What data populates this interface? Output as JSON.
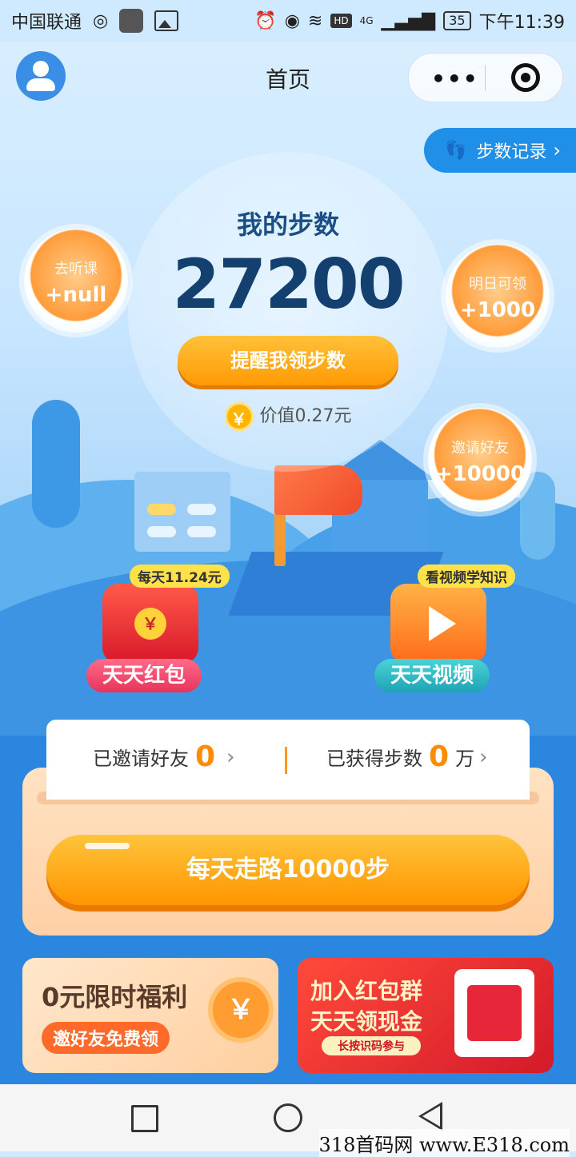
{
  "status_bar": {
    "carrier": "中国联通",
    "network": "4G",
    "battery": "35",
    "time": "下午11:39"
  },
  "header": {
    "title": "首页",
    "step_record_label": "步数记录"
  },
  "steps": {
    "label": "我的步数",
    "count": "27200",
    "remind_button": "提醒我领步数",
    "value_text": "价值0.27元"
  },
  "bubbles": {
    "listen": {
      "title": "去听课",
      "value": "+null"
    },
    "tomorrow": {
      "title": "明日可领",
      "value": "+1000"
    },
    "invite": {
      "title": "邀请好友",
      "value": "+10000"
    }
  },
  "features": {
    "hongbao": {
      "tag": "每天11.24元",
      "name": "天天红包",
      "symbol": "￥"
    },
    "video": {
      "tag": "看视频学知识",
      "name": "天天视频"
    }
  },
  "stats": {
    "invited_label": "已邀请好友",
    "invited_count": "0",
    "steps_label": "已获得步数",
    "steps_count": "0",
    "steps_unit": "万"
  },
  "walk_button": "每天走路10000步",
  "banners": {
    "welfare": {
      "title": "0元限时福利",
      "subtitle": "邀好友免费领",
      "symbol": "￥"
    },
    "group": {
      "line1": "加入红包群",
      "line2": "天天领现金",
      "pill": "长按识码参与"
    }
  },
  "watermark": "318首码网 www.E318.com",
  "icons": {
    "coin": "￥",
    "chevron": "›"
  },
  "colors": {
    "accent_orange": "#ff9a05",
    "primary_blue": "#1f8fe8",
    "title_blue": "#14406f"
  }
}
